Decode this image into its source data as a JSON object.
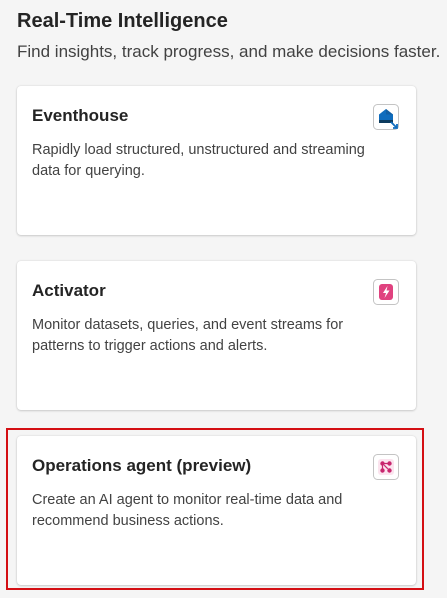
{
  "section": {
    "title": "Real-Time Intelligence",
    "subtitle": "Find insights, track progress, and make decisions faster."
  },
  "cards": [
    {
      "title": "Eventhouse",
      "description": "Rapidly load structured, unstructured and streaming data for querying.",
      "icon": "eventhouse-icon",
      "accent": "#0f6cbd"
    },
    {
      "title": "Activator",
      "description": "Monitor datasets, queries, and event streams for patterns to trigger actions and alerts.",
      "icon": "activator-icon",
      "accent": "#d4307f"
    },
    {
      "title": "Operations agent (preview)",
      "description": "Create an AI agent to monitor real-time data and recommend business actions.",
      "icon": "operations-agent-icon",
      "accent": "#c8256e"
    }
  ],
  "highlight_color": "#d40f14"
}
